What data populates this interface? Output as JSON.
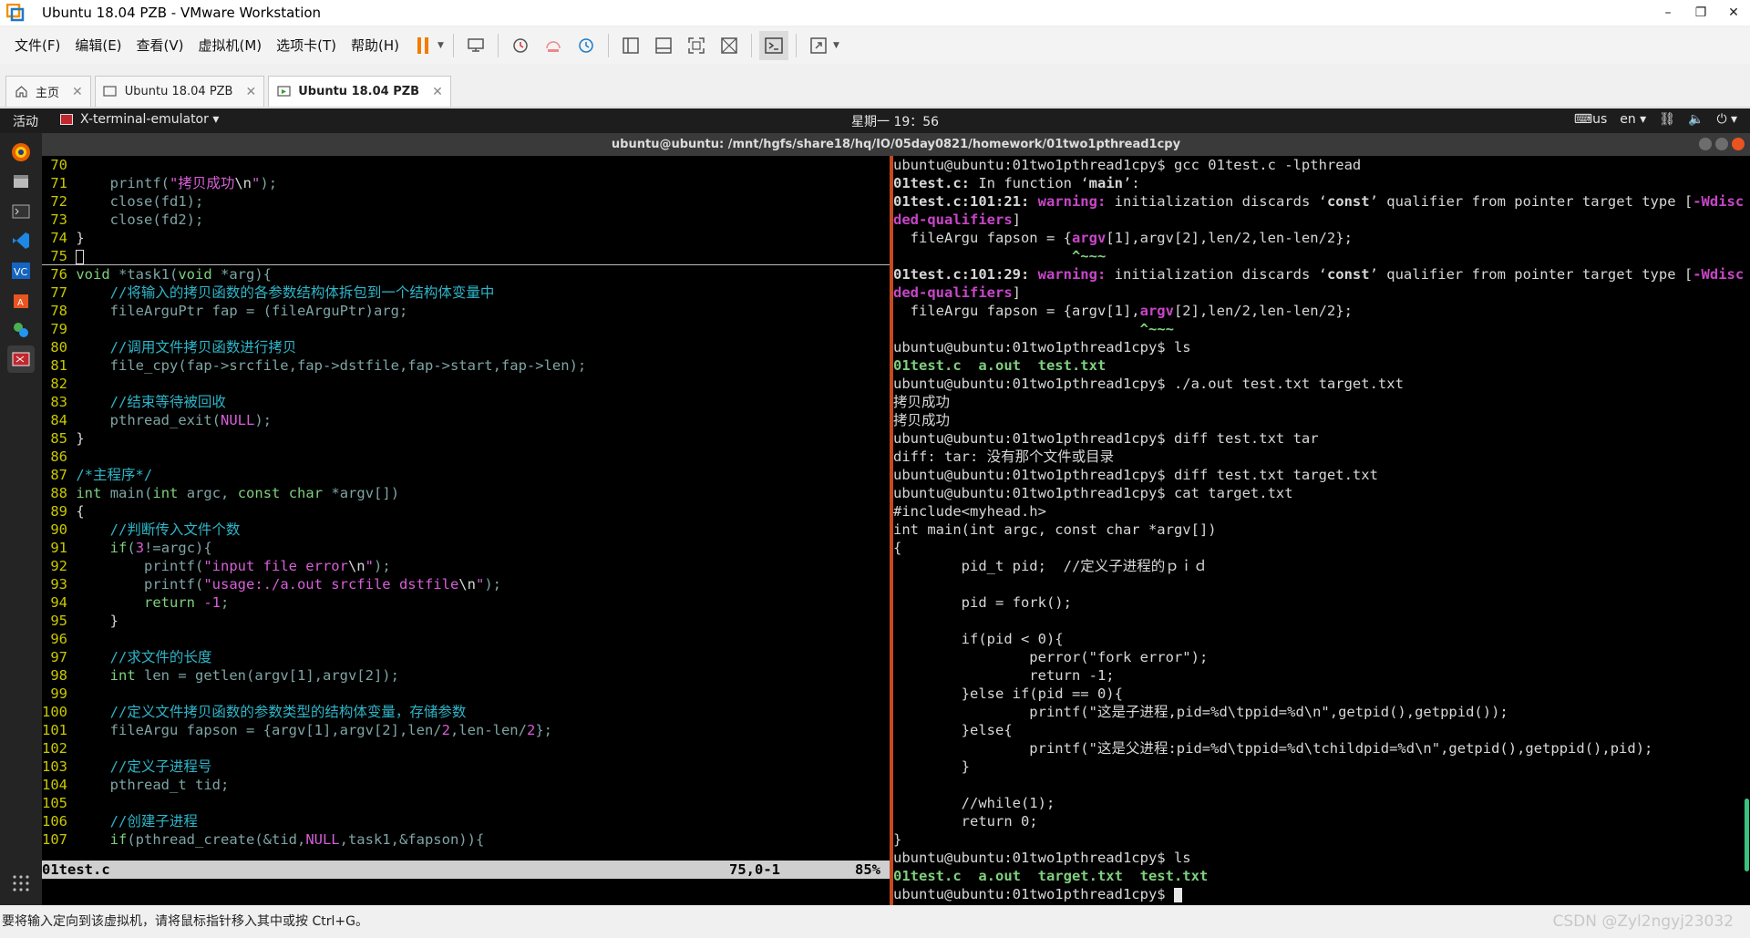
{
  "window": {
    "title": "Ubuntu 18.04 PZB - VMware Workstation",
    "minimize": "–",
    "restore": "❐",
    "close": "✕"
  },
  "menu": [
    "文件(F)",
    "编辑(E)",
    "查看(V)",
    "虚拟机(M)",
    "选项卡(T)",
    "帮助(H)"
  ],
  "tabs": [
    {
      "label": "主页"
    },
    {
      "label": "Ubuntu 18.04 PZB"
    },
    {
      "label": "Ubuntu 18.04 PZB"
    }
  ],
  "gnome": {
    "activities": "活动",
    "app": "X-terminal-emulator ▾",
    "clock": "星期一 19：56",
    "keyboard": "us",
    "lang": "en ▾"
  },
  "terminal_title": "ubuntu@ubuntu: /mnt/hgfs/share18/hq/IO/05day0821/homework/01two1pthread1cpy",
  "vim_status": {
    "file": "01test.c",
    "pos": "75,0-1",
    "percent": "85%"
  },
  "vm_status_text": "要将输入定向到该虚拟机，请将鼠标指针移入其中或按 Ctrl+G。",
  "watermark": "CSDN @Zyl2ngyj23032",
  "colors": {
    "accent_orange": "#e95420",
    "vim_linenum": "#c8c800",
    "comment": "#2eb5c8",
    "string": "#d75fd7"
  }
}
